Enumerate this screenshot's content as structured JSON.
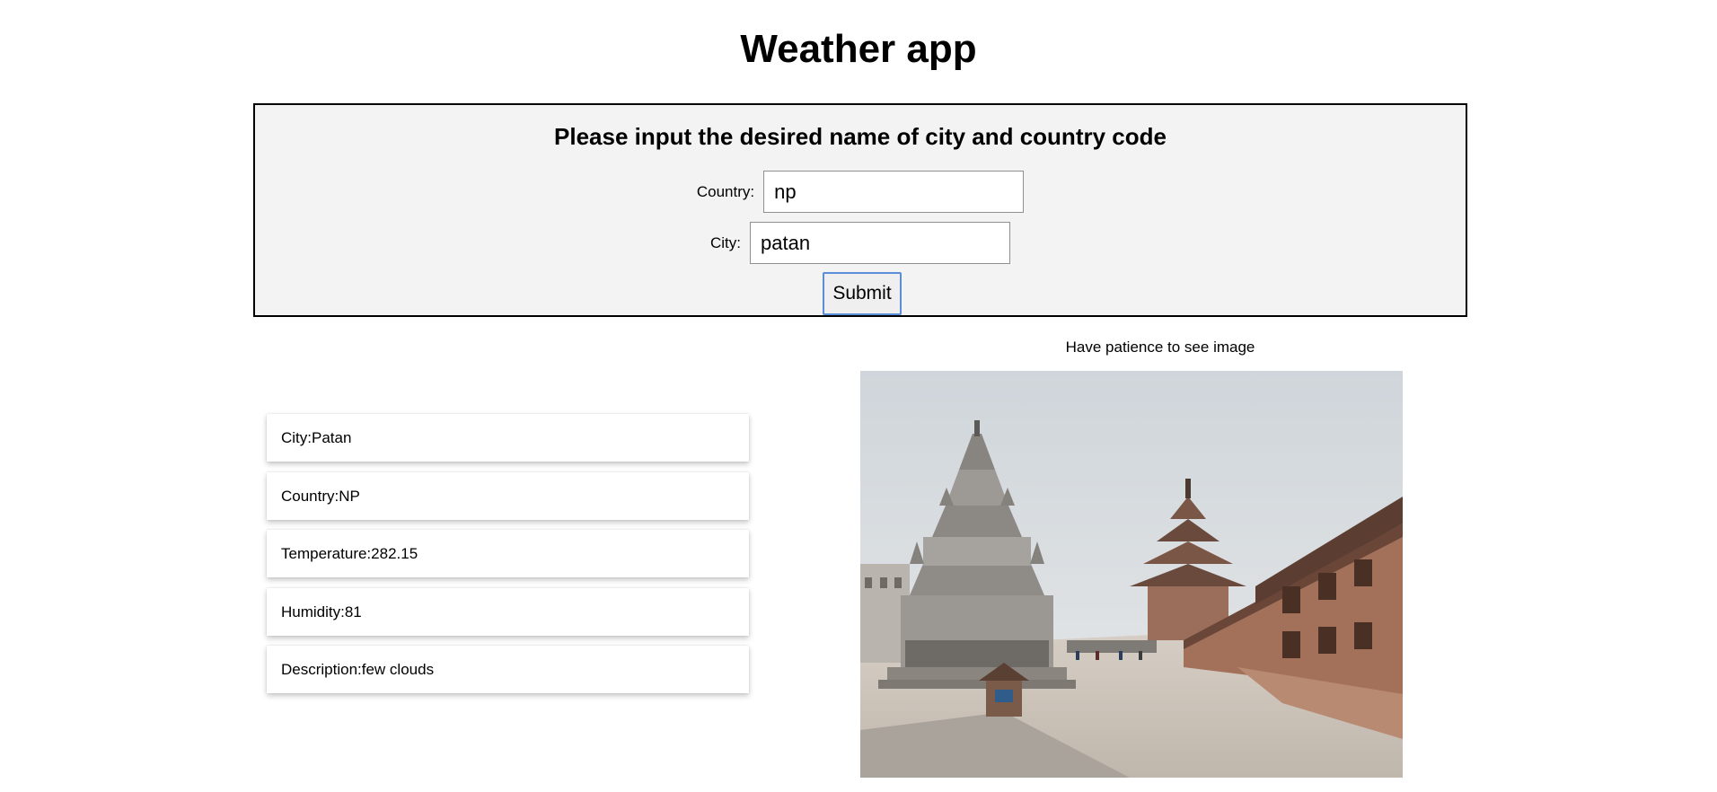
{
  "header": {
    "title": "Weather app"
  },
  "form": {
    "heading": "Please input the desired name of city and country code",
    "country_label": "Country:",
    "country_value": "np",
    "city_label": "City:",
    "city_value": "patan",
    "submit_label": "Submit"
  },
  "image": {
    "caption": "Have patience to see image",
    "alt": "Patan Durbar Square temples"
  },
  "results": {
    "city": "City:Patan",
    "country": "Country:NP",
    "temperature": "Temperature:282.15",
    "humidity": "Humidity:81",
    "description": "Description:few clouds"
  },
  "colors": {
    "panel_background": "#f3f3f3",
    "submit_border": "#5a8ed6"
  }
}
